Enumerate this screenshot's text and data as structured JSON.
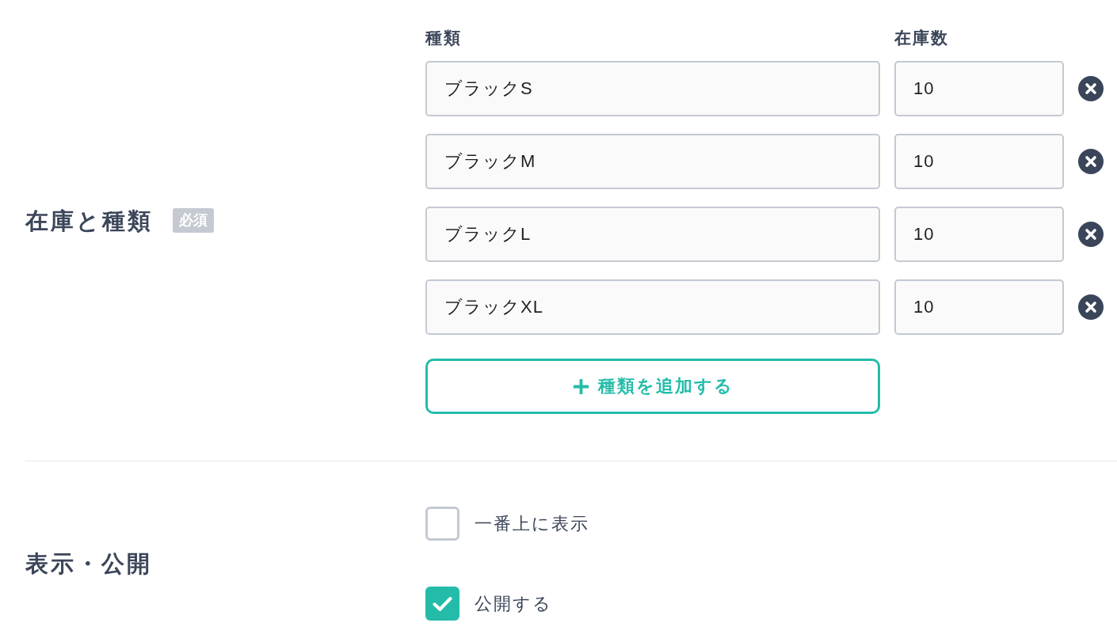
{
  "inventory": {
    "label": "在庫と種類",
    "badge": "必須",
    "columns": [
      "種類",
      "在庫数"
    ],
    "rows": [
      {
        "variant": "ブラックS",
        "stock": "10"
      },
      {
        "variant": "ブラックM",
        "stock": "10"
      },
      {
        "variant": "ブラックL",
        "stock": "10"
      },
      {
        "variant": "ブラックXL",
        "stock": "10"
      }
    ],
    "add_button": "種類を追加する"
  },
  "visibility": {
    "label": "表示・公開",
    "options": [
      {
        "label": "一番上に表示",
        "checked": false
      },
      {
        "label": "公開する",
        "checked": true
      }
    ]
  }
}
